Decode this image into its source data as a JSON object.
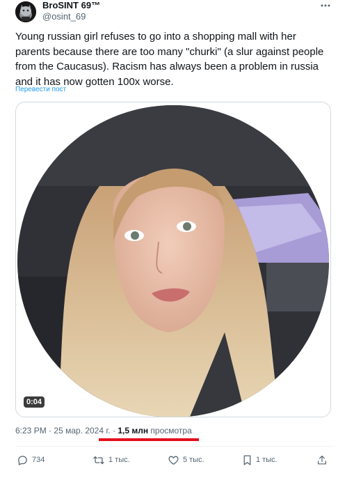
{
  "author": {
    "name": "BroSINT 69™",
    "handle": "@osint_69"
  },
  "tweet": {
    "text": "Young russian girl refuses to go into a shopping mall with her parents because there are too many \"churki\" (a slur against people from the Caucasus). Racism has always been a problem in russia and it has now gotten 100x worse.",
    "translate_label": "Перевести пост"
  },
  "media": {
    "duration": "0:04"
  },
  "meta": {
    "time": "6:23 PM",
    "separator": "·",
    "date": "25 мар. 2024 г.",
    "views_count": "1,5 млн",
    "views_label": "просмотра"
  },
  "actions": {
    "replies": "734",
    "reposts": "1 тыс.",
    "likes": "5 тыс.",
    "bookmarks": "1 тыс."
  },
  "colors": {
    "link": "#1d9bf0",
    "secondary_text": "#536471",
    "primary_text": "#0f1419",
    "highlight_underline": "#e4101e"
  },
  "icons": [
    "more-icon",
    "reply-icon",
    "repost-icon",
    "like-icon",
    "bookmark-icon",
    "share-icon"
  ]
}
